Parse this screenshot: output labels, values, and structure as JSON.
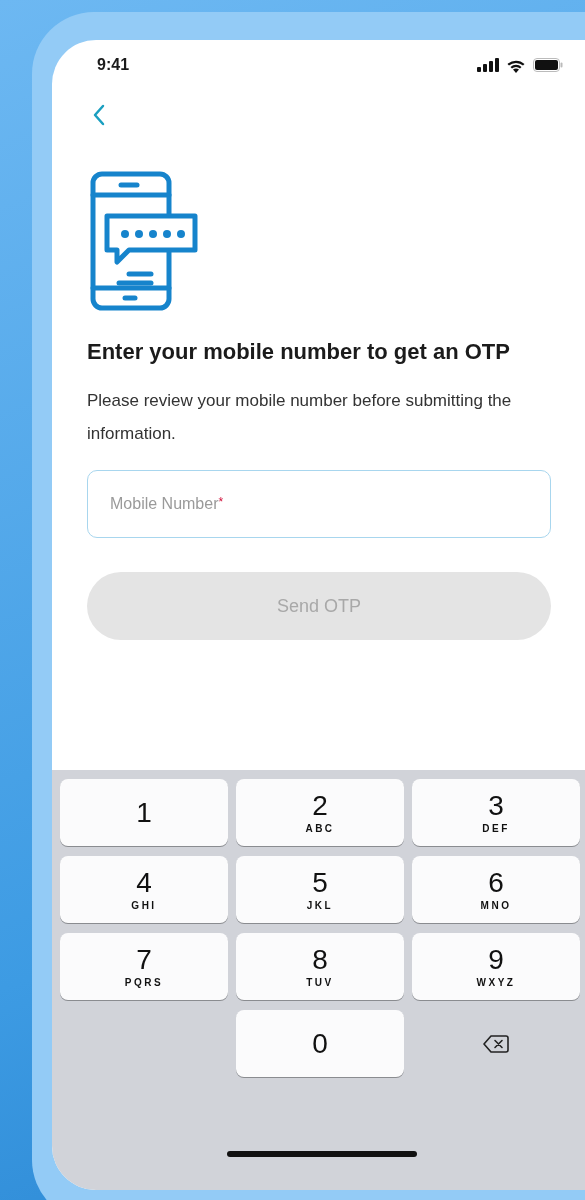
{
  "status_bar": {
    "time": "9:41"
  },
  "heading": "Enter your mobile number to get an OTP",
  "description": "Please review your mobile number before submitting the information.",
  "mobile_field": {
    "label": "Mobile Number",
    "required_mark": "*"
  },
  "send_button": {
    "label": "Send OTP",
    "disabled": true
  },
  "keypad": [
    {
      "kind": "digit",
      "digit": "1"
    },
    {
      "kind": "digit",
      "digit": "2",
      "letters": "ABC"
    },
    {
      "kind": "digit",
      "digit": "3",
      "letters": "DEF"
    },
    {
      "kind": "digit",
      "digit": "4",
      "letters": "GHI"
    },
    {
      "kind": "digit",
      "digit": "5",
      "letters": "JKL"
    },
    {
      "kind": "digit",
      "digit": "6",
      "letters": "MNO"
    },
    {
      "kind": "digit",
      "digit": "7",
      "letters": "PQRS"
    },
    {
      "kind": "digit",
      "digit": "8",
      "letters": "TUV"
    },
    {
      "kind": "digit",
      "digit": "9",
      "letters": "WXYZ"
    },
    {
      "kind": "digit",
      "digit": "0"
    },
    {
      "kind": "backspace"
    }
  ]
}
